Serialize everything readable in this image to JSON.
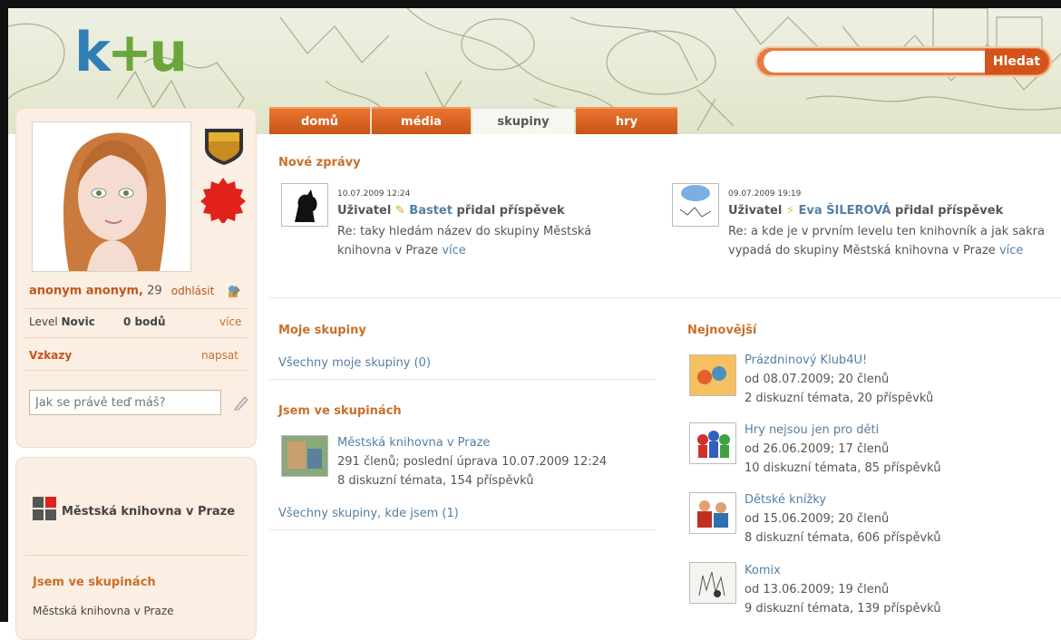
{
  "search": {
    "placeholder": "",
    "button_label": "Hledat"
  },
  "tabs": [
    {
      "label": "domů"
    },
    {
      "label": "média"
    },
    {
      "label": "skupiny"
    },
    {
      "label": "hry"
    }
  ],
  "profile": {
    "name": "anonym anonym,",
    "age": "29",
    "logout_label": "odhlásit",
    "level_label": "Level",
    "level_value": "Novic",
    "points": "0 bodů",
    "more_label": "více",
    "messages_label": "Vzkazy",
    "write_label": "napsat",
    "status_placeholder": "Jak se právě teď máš?"
  },
  "sidebar2": {
    "library_name": "Městská knihovna v Praze",
    "groups_heading": "Jsem ve skupinách",
    "group_item": "Městská knihovna v Praze"
  },
  "news": {
    "heading": "Nové zprávy",
    "items": [
      {
        "date": "10.07.2009 12:24",
        "prefix": "Uživatel",
        "user": "Bastet",
        "action": "přidal příspěvek",
        "body": "Re: taky hledám název do skupiny Městská knihovna v Praze",
        "more": "více"
      },
      {
        "date": "09.07.2009 19:19",
        "prefix": "Uživatel",
        "user": "Eva ŠILEROVÁ",
        "action": "přidal příspěvek",
        "body": "Re: a kde je v prvním levelu ten knihovník a jak sakra vypadá do skupiny Městská knihovna v Praze",
        "more": "více"
      }
    ]
  },
  "my_groups": {
    "heading": "Moje skupiny",
    "all_link": "Všechny moje skupiny (0)",
    "member_heading": "Jsem ve skupinách",
    "member_group": {
      "name": "Městská knihovna v Praze",
      "line1": "291 členů; poslední úprava 10.07.2009 12:24",
      "line2": "8 diskuzní témata, 154 příspěvků"
    },
    "all_member_link": "Všechny skupiny, kde jsem (1)"
  },
  "newest": {
    "heading": "Nejnovější",
    "groups": [
      {
        "name": "Prázdninový Klub4U!",
        "line1": "od 08.07.2009; 20 členů",
        "line2": "2 diskuzní témata, 20 příspěvků"
      },
      {
        "name": "Hry nejsou jen pro děti",
        "line1": "od 26.06.2009; 17 členů",
        "line2": "10 diskuzní témata, 85 příspěvků"
      },
      {
        "name": "Dětské knížky",
        "line1": "od 15.06.2009; 20 členů",
        "line2": "8 diskuzní témata, 606 příspěvků"
      },
      {
        "name": "Komix",
        "line1": "od 13.06.2009; 19 členů",
        "line2": "9 diskuzní témata, 139 příspěvků"
      }
    ]
  },
  "colors": {
    "accent": "#e8752f",
    "link": "#557fa3",
    "heading": "#c8702c"
  }
}
